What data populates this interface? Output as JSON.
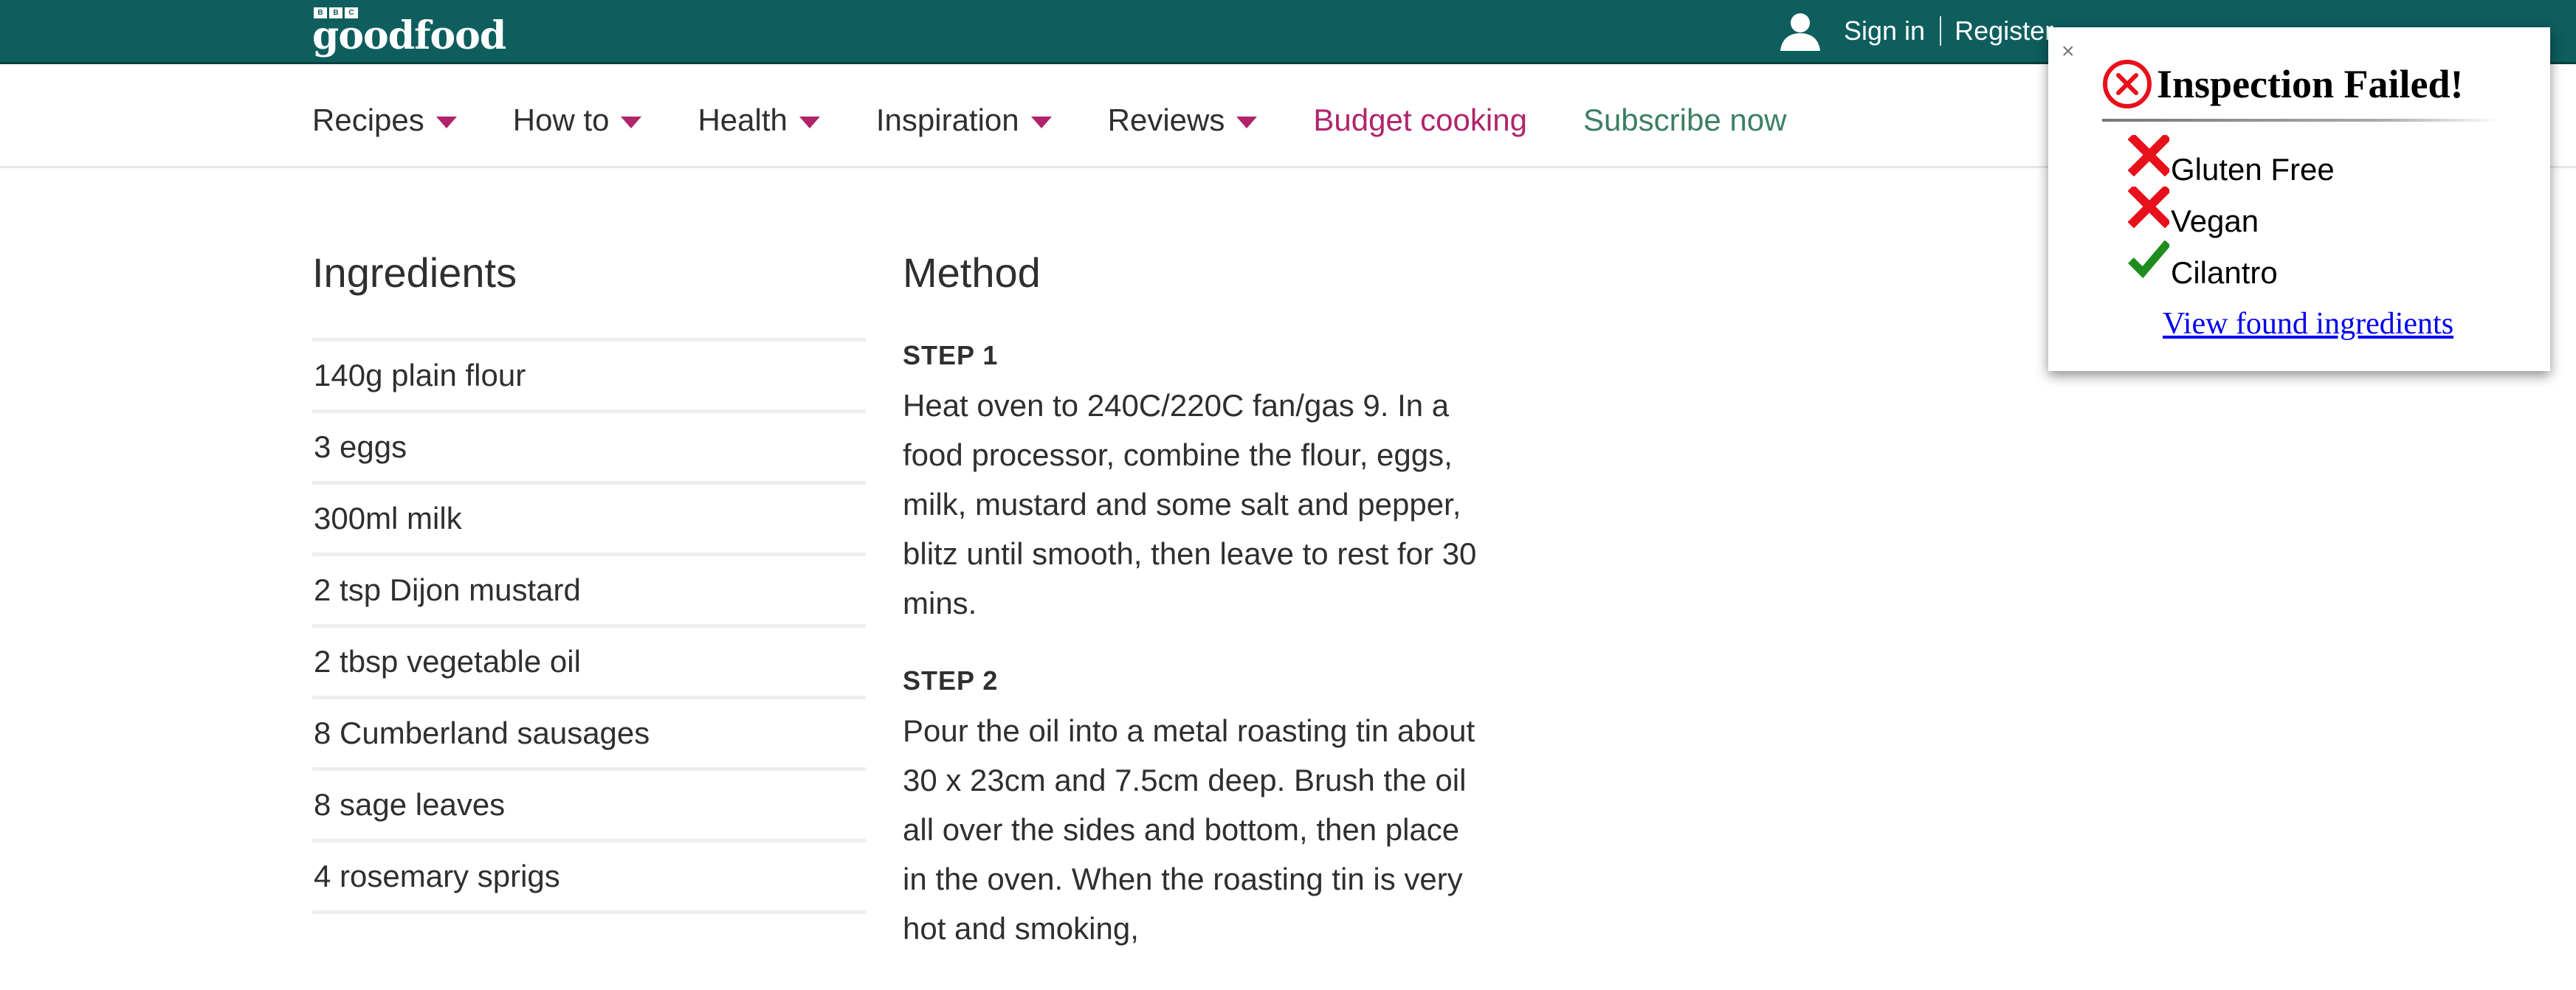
{
  "header": {
    "bbc_letters": [
      "B",
      "B",
      "C"
    ],
    "brand": "goodfood",
    "sign_in": "Sign in",
    "register": "Register"
  },
  "nav": {
    "items": [
      {
        "label": "Recipes"
      },
      {
        "label": "How to"
      },
      {
        "label": "Health"
      },
      {
        "label": "Inspiration"
      },
      {
        "label": "Reviews"
      }
    ],
    "budget": "Budget cooking",
    "subscribe": "Subscribe now"
  },
  "ingredients": {
    "title": "Ingredients",
    "items": [
      "140g plain flour",
      "3 eggs",
      "300ml milk",
      "2 tsp Dijon mustard",
      "2 tbsp vegetable oil",
      "8 Cumberland sausages",
      "8 sage leaves",
      "4 rosemary sprigs"
    ]
  },
  "method": {
    "title": "Method",
    "steps": [
      {
        "label": "STEP 1",
        "text": "Heat oven to 240C/220C fan/gas 9. In a food processor, combine the flour, eggs, milk, mustard and some salt and pepper, blitz until smooth, then leave to rest for 30 mins."
      },
      {
        "label": "STEP 2",
        "text": "Pour the oil into a metal roasting tin about 30 x 23cm and 7.5cm deep. Brush the oil all over the sides and bottom, then place in the oven. When the roasting tin is very hot and smoking,"
      }
    ]
  },
  "popup": {
    "close": "×",
    "title": "Inspection Failed!",
    "checks": [
      {
        "label": "Gluten Free",
        "status": "fail",
        "icon": "red-x-icon"
      },
      {
        "label": "Vegan",
        "status": "fail",
        "icon": "red-x-icon"
      },
      {
        "label": "Cilantro",
        "status": "pass",
        "icon": "green-check-icon"
      }
    ],
    "link": "View found ingredients",
    "colors": {
      "fail": "#e8101a",
      "pass": "#1e8c1e",
      "link": "#0000ee"
    }
  },
  "colors": {
    "topbar": "#0e5e5e",
    "accent": "#b0246a",
    "subscribe": "#3c7f63"
  }
}
